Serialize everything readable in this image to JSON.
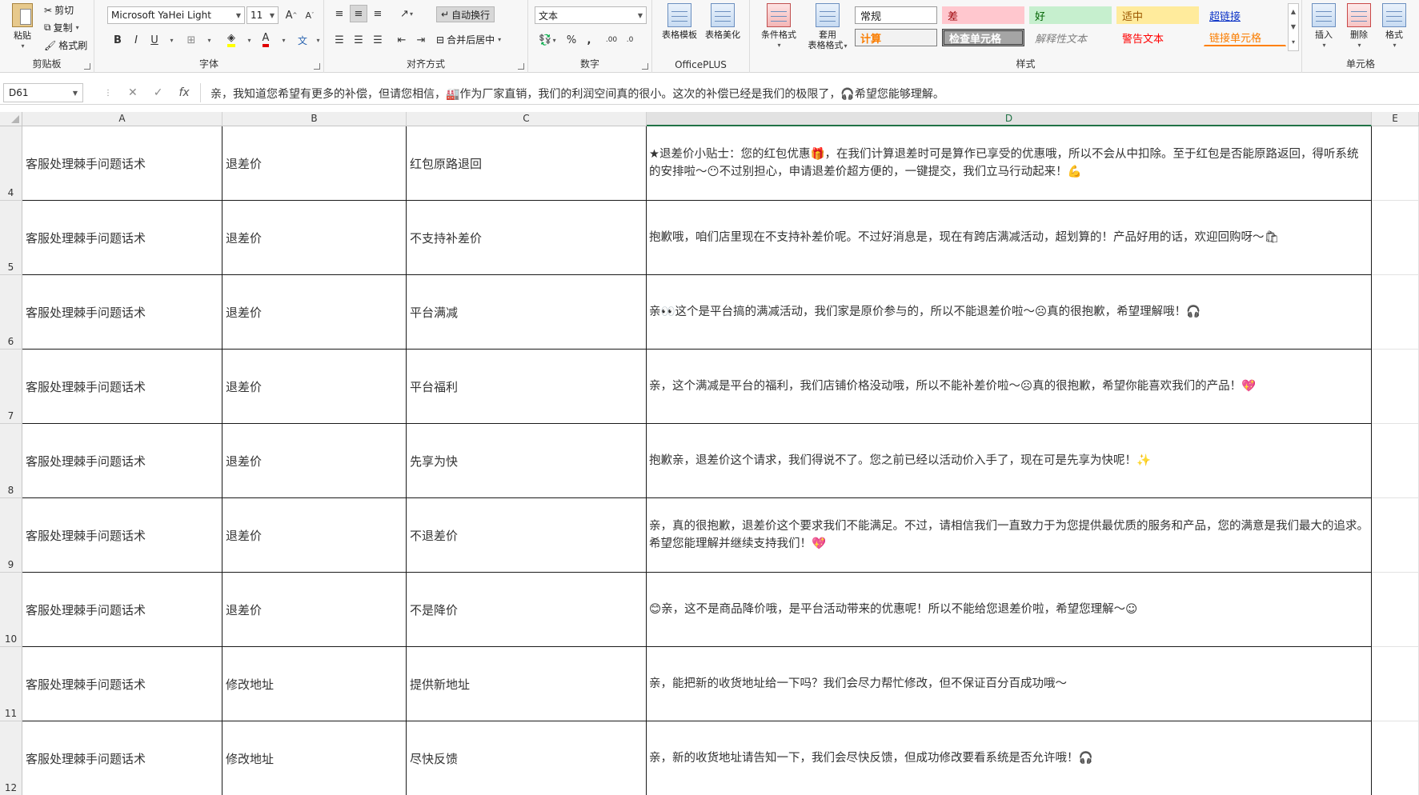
{
  "ribbon": {
    "clipboard": {
      "label": "剪贴板",
      "paste": "粘贴",
      "cut": "剪切",
      "copy": "复制",
      "format_painter": "格式刷"
    },
    "font": {
      "label": "字体",
      "family": "Microsoft YaHei Light",
      "size": "11"
    },
    "alignment": {
      "label": "对齐方式",
      "wrap": "自动换行",
      "merge": "合并后居中"
    },
    "number": {
      "label": "数字",
      "format": "文本"
    },
    "officeplus": {
      "label": "OfficePLUS",
      "template": "表格模板",
      "beautify": "表格美化"
    },
    "styles": {
      "label": "样式",
      "conditional": "条件格式",
      "table_format_1": "套用",
      "table_format_2": "表格格式",
      "items": [
        {
          "label": "常规"
        },
        {
          "label": "差"
        },
        {
          "label": "好"
        },
        {
          "label": "适中"
        },
        {
          "label": "超链接"
        },
        {
          "label": "计算"
        },
        {
          "label": "检查单元格"
        },
        {
          "label": "解释性文本"
        },
        {
          "label": "警告文本"
        },
        {
          "label": "链接单元格"
        }
      ]
    },
    "cells": {
      "label": "单元格",
      "insert": "插入",
      "delete": "删除",
      "format": "格式"
    }
  },
  "formula_bar": {
    "name_box": "D61",
    "fx": "fx",
    "content": "亲，我知道您希望有更多的补偿，但请您相信，🏭作为厂家直销，我们的利润空间真的很小。这次的补偿已经是我们的极限了，🎧希望您能够理解。"
  },
  "columns": [
    "A",
    "B",
    "C",
    "D",
    "E"
  ],
  "rows": [
    {
      "num": "4",
      "a": "客服处理棘手问题话术",
      "b": "退差价",
      "c": "红包原路退回",
      "d": "★退差价小贴士：您的红包优惠🎁，在我们计算退差时可是算作已享受的优惠哦，所以不会从中扣除。至于红包是否能原路返回，得听系统的安排啦～😶不过别担心，申请退差价超方便的，一键提交，我们立马行动起来！💪"
    },
    {
      "num": "5",
      "a": "客服处理棘手问题话术",
      "b": "退差价",
      "c": "不支持补差价",
      "d": "抱歉哦，咱们店里现在不支持补差价呢。不过好消息是，现在有跨店满减活动，超划算的！产品好用的话，欢迎回购呀～🛍"
    },
    {
      "num": "6",
      "a": "客服处理棘手问题话术",
      "b": "退差价",
      "c": "平台满减",
      "d": "亲👀这个是平台搞的满减活动，我们家是原价参与的，所以不能退差价啦～☹真的很抱歉，希望理解哦！🎧"
    },
    {
      "num": "7",
      "a": "客服处理棘手问题话术",
      "b": "退差价",
      "c": "平台福利",
      "d": "亲，这个满减是平台的福利，我们店铺价格没动哦，所以不能补差价啦～☹真的很抱歉，希望你能喜欢我们的产品！💖"
    },
    {
      "num": "8",
      "a": "客服处理棘手问题话术",
      "b": "退差价",
      "c": "先享为快",
      "d": "抱歉亲，退差价这个请求，我们得说不了。您之前已经以活动价入手了，现在可是先享为快呢！✨"
    },
    {
      "num": "9",
      "a": "客服处理棘手问题话术",
      "b": "退差价",
      "c": "不退差价",
      "d": "亲，真的很抱歉，退差价这个要求我们不能满足。不过，请相信我们一直致力于为您提供最优质的服务和产品，您的满意是我们最大的追求。希望您能理解并继续支持我们！💖"
    },
    {
      "num": "10",
      "a": "客服处理棘手问题话术",
      "b": "退差价",
      "c": "不是降价",
      "d": "😊亲，这不是商品降价哦，是平台活动带来的优惠呢！所以不能给您退差价啦，希望您理解～☺"
    },
    {
      "num": "11",
      "a": "客服处理棘手问题话术",
      "b": "修改地址",
      "c": "提供新地址",
      "d": "亲，能把新的收货地址给一下吗？我们会尽力帮忙修改，但不保证百分百成功哦～"
    },
    {
      "num": "12",
      "a": "客服处理棘手问题话术",
      "b": "修改地址",
      "c": "尽快反馈",
      "d": "亲，新的收货地址请告知一下，我们会尽快反馈，但成功修改要看系统是否允许哦！🎧"
    }
  ]
}
